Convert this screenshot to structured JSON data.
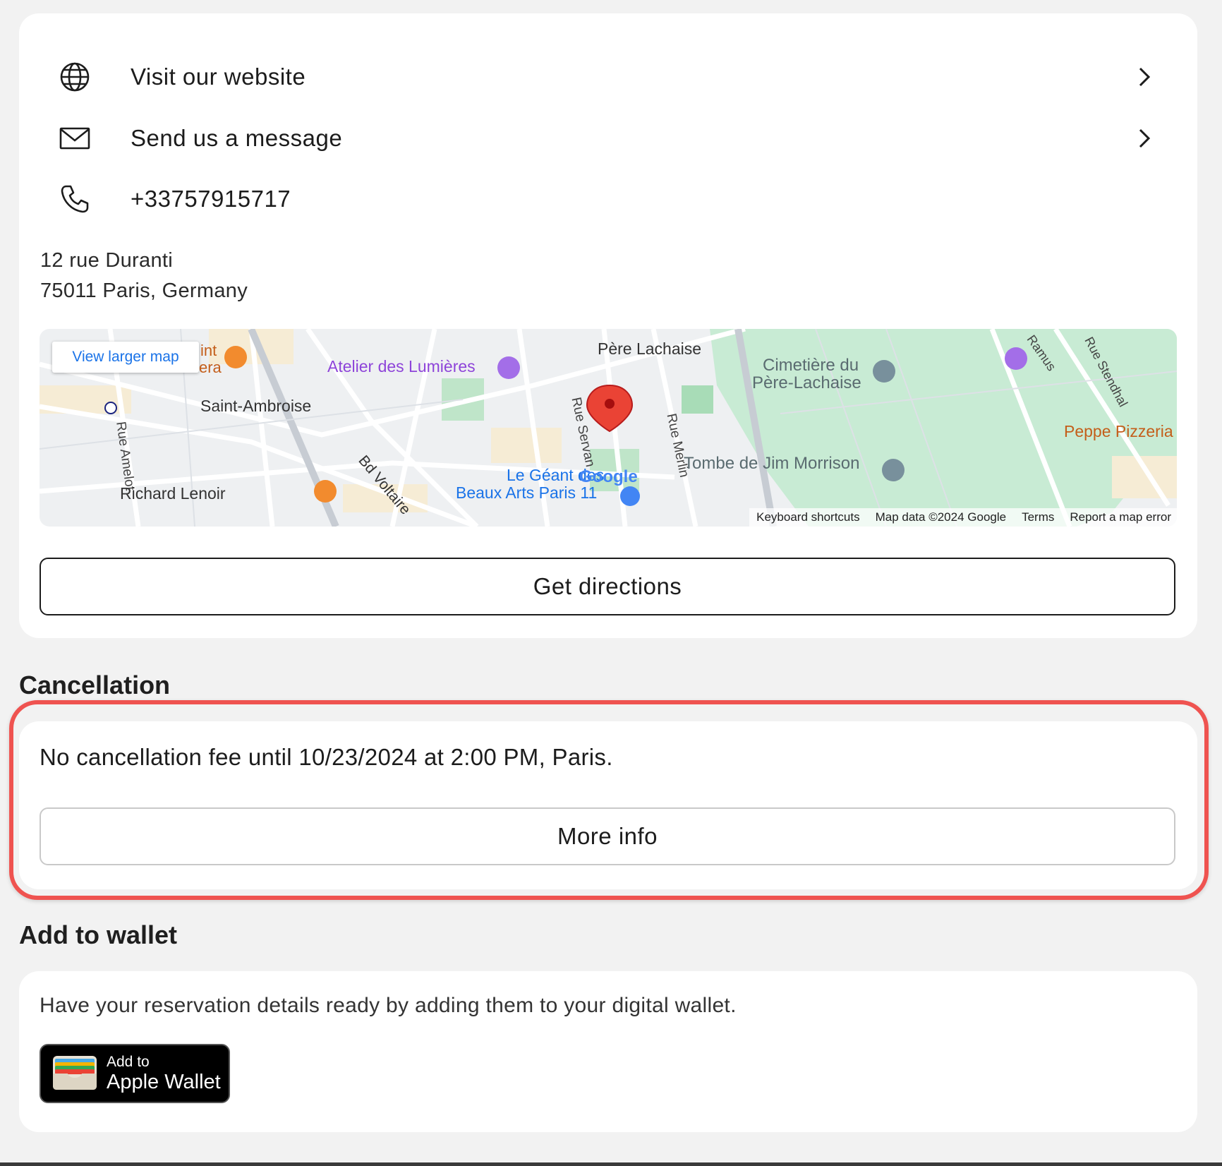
{
  "contact": {
    "website_label": "Visit our website",
    "message_label": "Send us a message",
    "phone_label": "+33757915717",
    "icons": [
      "globe-icon",
      "envelope-icon",
      "phone-icon",
      "chevron-right-icon"
    ]
  },
  "address": {
    "line1": "12 rue Duranti",
    "line2": "75011 Paris, Germany"
  },
  "map": {
    "view_larger": "View larger map",
    "labels": {
      "atelier": "Atelier des Lumières",
      "pere_lachaise": "Père Lachaise",
      "cimetiere_1": "Cimetière du",
      "cimetiere_2": "Père-Lachaise",
      "saint_ambroise": "Saint-Ambroise",
      "bd_voltaire": "Bd Voltaire",
      "rue_servan": "Rue Servan",
      "rue_merlin": "Rue Merlin",
      "rue_amelot": "Rue Amelot",
      "richard_lenoir": "Richard Lenoir",
      "tombe": "Tombe de Jim Morrison",
      "peppe": "Peppe Pizzeria",
      "ramus": "Ramus",
      "rue_stendhal": "Rue Stendhal",
      "geant_1": "Le Géant des",
      "geant_2": "Beaux Arts Paris 11",
      "partial_int": "int",
      "partial_era": "era",
      "google": "Google"
    },
    "attribution": {
      "shortcuts": "Keyboard shortcuts",
      "data": "Map data ©2024 Google",
      "terms": "Terms",
      "report": "Report a map error"
    }
  },
  "directions": {
    "label": "Get directions"
  },
  "cancellation": {
    "title": "Cancellation",
    "text": "No cancellation fee until 10/23/2024 at 2:00 PM, Paris.",
    "more_info": "More info",
    "highlight_color": "#ef5350"
  },
  "wallet": {
    "title": "Add to wallet",
    "text": "Have your reservation details ready by adding them to your digital wallet.",
    "button_small": "Add to",
    "button_big": "Apple Wallet"
  }
}
